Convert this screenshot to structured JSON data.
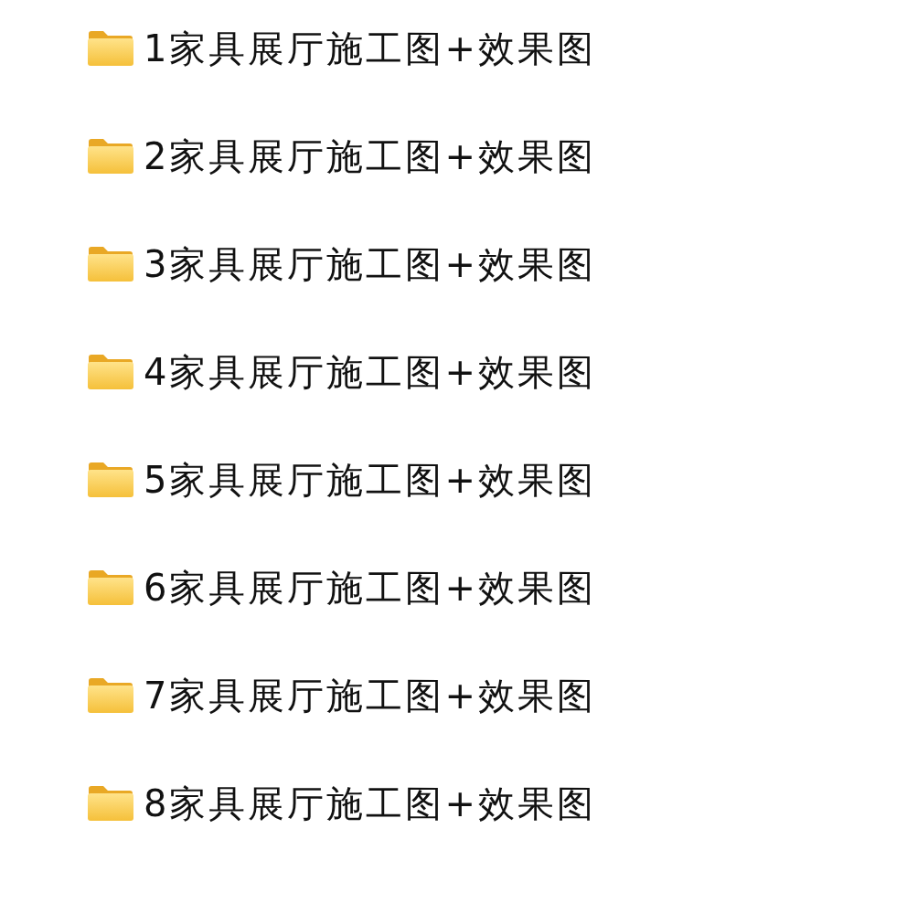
{
  "folders": [
    {
      "name": "1家具展厅施工图+效果图"
    },
    {
      "name": "2家具展厅施工图+效果图"
    },
    {
      "name": "3家具展厅施工图+效果图"
    },
    {
      "name": "4家具展厅施工图+效果图"
    },
    {
      "name": "5家具展厅施工图+效果图"
    },
    {
      "name": "6家具展厅施工图+效果图"
    },
    {
      "name": "7家具展厅施工图+效果图"
    },
    {
      "name": "8家具展厅施工图+效果图"
    }
  ]
}
